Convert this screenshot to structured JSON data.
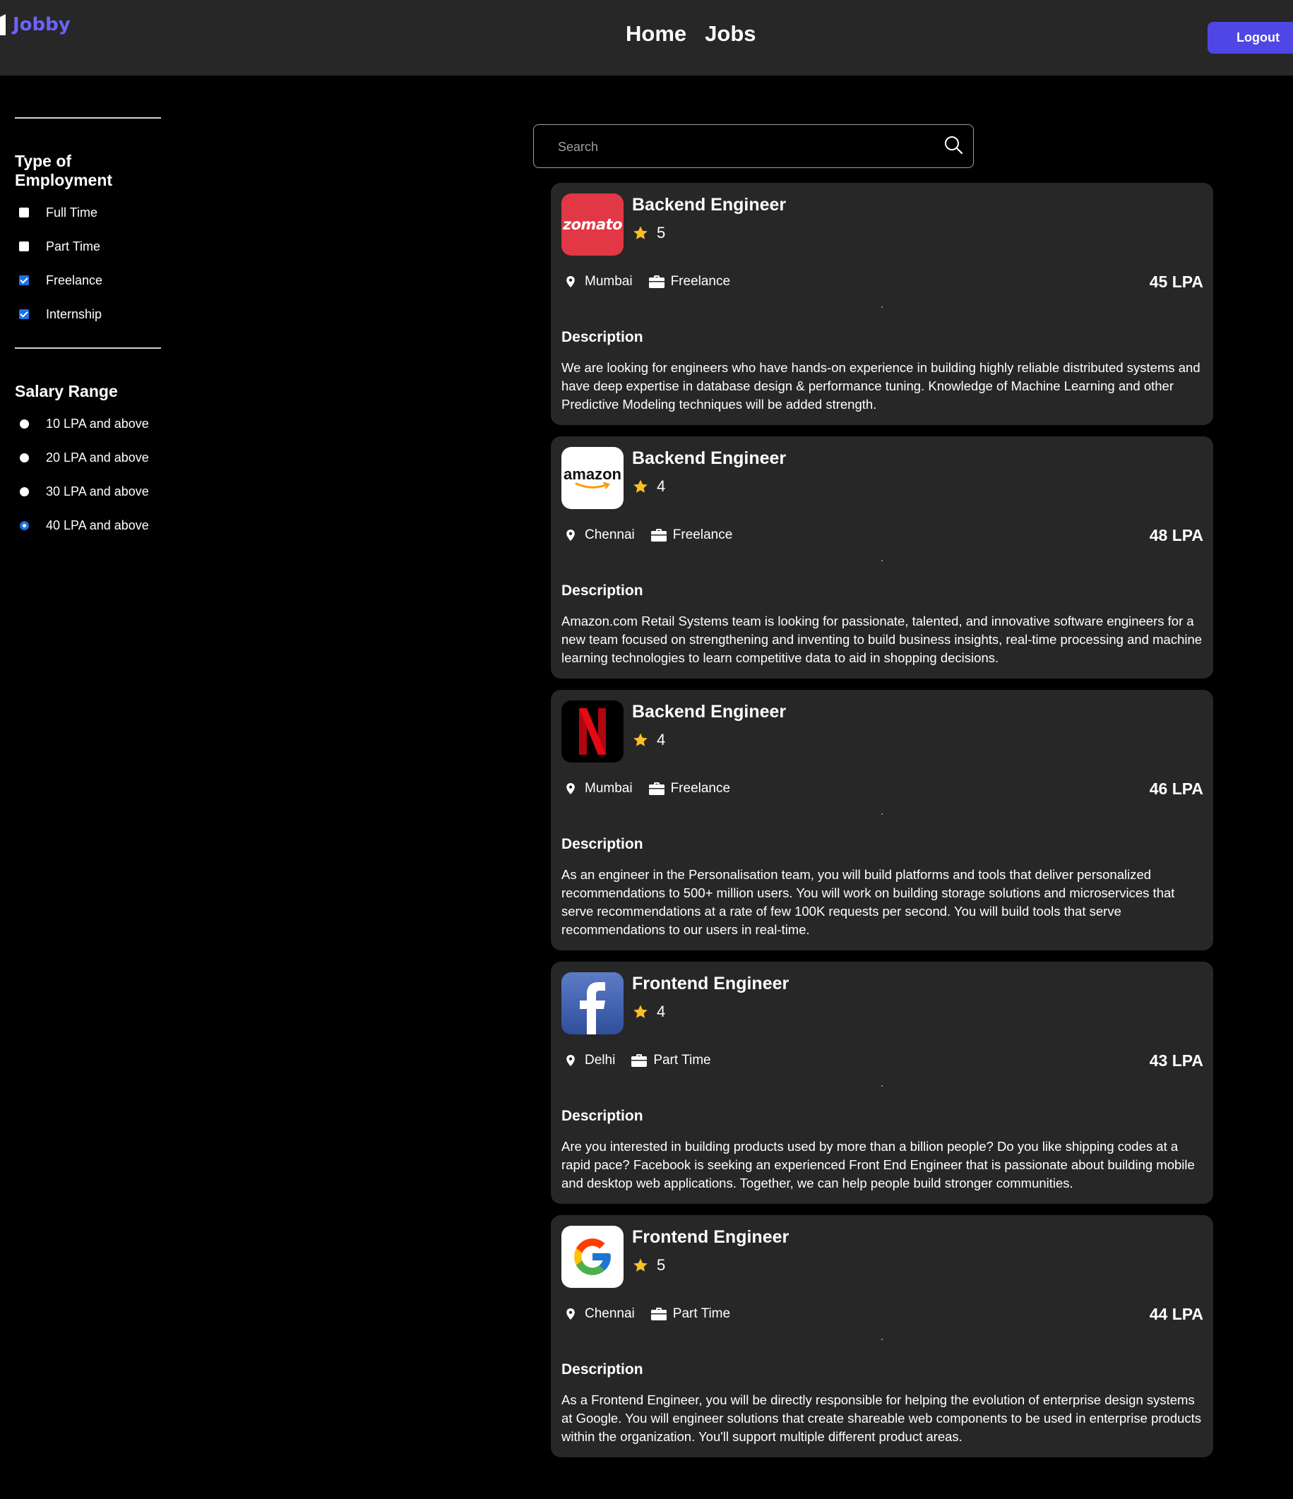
{
  "header": {
    "logo_text": "Jobby",
    "nav": [
      "Home",
      "Jobs"
    ],
    "logout_label": "Logout"
  },
  "filters": {
    "employment": {
      "title": "Type of Employment",
      "options": [
        {
          "label": "Full Time",
          "checked": false
        },
        {
          "label": "Part Time",
          "checked": false
        },
        {
          "label": "Freelance",
          "checked": true
        },
        {
          "label": "Internship",
          "checked": true
        }
      ]
    },
    "salary": {
      "title": "Salary Range",
      "options": [
        {
          "label": "10 LPA and above",
          "checked": false
        },
        {
          "label": "20 LPA and above",
          "checked": false
        },
        {
          "label": "30 LPA and above",
          "checked": false
        },
        {
          "label": "40 LPA and above",
          "checked": true
        }
      ]
    }
  },
  "search": {
    "placeholder": "Search",
    "value": ""
  },
  "jobs": [
    {
      "company": "zomato",
      "title": "Backend Engineer",
      "rating": "5",
      "location": "Mumbai",
      "employment_type": "Freelance",
      "salary": "45 LPA",
      "desc_title": "Description",
      "description": "We are looking for engineers who have hands-on experience in building highly reliable distributed systems and have deep expertise in database design & performance tuning. Knowledge of Machine Learning and other Predictive Modeling techniques will be added strength."
    },
    {
      "company": "amazon",
      "title": "Backend Engineer",
      "rating": "4",
      "location": "Chennai",
      "employment_type": "Freelance",
      "salary": "48 LPA",
      "desc_title": "Description",
      "description": "Amazon.com Retail Systems team is looking for passionate, talented, and innovative software engineers for a new team focused on strengthening and inventing to build business insights, real-time processing and machine learning technologies to learn competitive data to aid in shopping decisions."
    },
    {
      "company": "netflix",
      "title": "Backend Engineer",
      "rating": "4",
      "location": "Mumbai",
      "employment_type": "Freelance",
      "salary": "46 LPA",
      "desc_title": "Description",
      "description": "As an engineer in the Personalisation team, you will build platforms and tools that deliver personalized recommendations to 500+ million users. You will work on building storage solutions and microservices that serve recommendations at a rate of few 100K requests per second. You will build tools that serve recommendations to our users in real-time."
    },
    {
      "company": "facebook",
      "title": "Frontend Engineer",
      "rating": "4",
      "location": "Delhi",
      "employment_type": "Part Time",
      "salary": "43 LPA",
      "desc_title": "Description",
      "description": "Are you interested in building products used by more than a billion people? Do you like shipping codes at a rapid pace? Facebook is seeking an experienced Front End Engineer that is passionate about building mobile and desktop web applications. Together, we can help people build stronger communities."
    },
    {
      "company": "google",
      "title": "Frontend Engineer",
      "rating": "5",
      "location": "Chennai",
      "employment_type": "Part Time",
      "salary": "44 LPA",
      "desc_title": "Description",
      "description": "As a Frontend Engineer, you will be directly responsible for helping the evolution of enterprise design systems at Google. You will engineer solutions that create shareable web components to be used in enterprise products within the organization. You'll support multiple different product areas."
    }
  ],
  "colors": {
    "accent": "#4f46e5",
    "logo": "#6c63ff",
    "card_bg": "#272727",
    "star": "#fbbf24",
    "checked": "#1a73e8"
  }
}
